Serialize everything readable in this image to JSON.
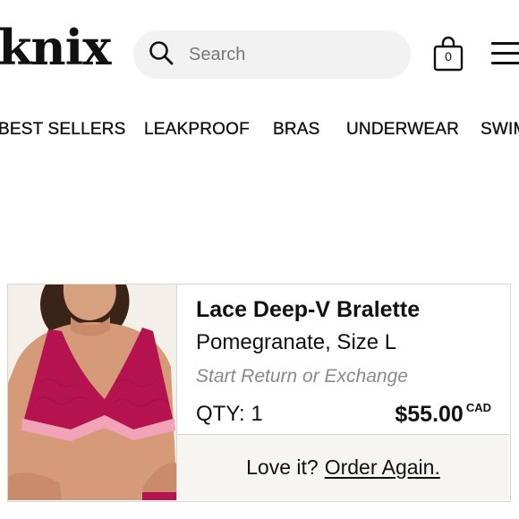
{
  "header": {
    "logo": "knix",
    "search_placeholder": "Search",
    "cart_count": "0",
    "icons": {
      "search": "search-icon",
      "cart": "shopping-bag-icon",
      "menu": "hamburger-menu-icon"
    }
  },
  "nav": {
    "items": [
      {
        "label": "BEST SELLERS"
      },
      {
        "label": "LEAKPROOF"
      },
      {
        "label": "BRAS"
      },
      {
        "label": "UNDERWEAR"
      },
      {
        "label": "SWIM"
      }
    ]
  },
  "order": {
    "product_name": "Lace Deep-V Bralette",
    "variant": "Pomegranate, Size L",
    "return_link": "Start Return or Exchange",
    "qty_label": "QTY:",
    "qty_value": "1",
    "price": "$55.00",
    "currency": "CAD",
    "reorder_prompt": "Love it?",
    "reorder_link": "Order Again."
  },
  "colors": {
    "bralette": "#b5134f",
    "bralette_band": "#f3a3b8",
    "skin": "#d59a78",
    "card_footer": "#f6f5f1",
    "search_bg": "#f2f2f2"
  }
}
